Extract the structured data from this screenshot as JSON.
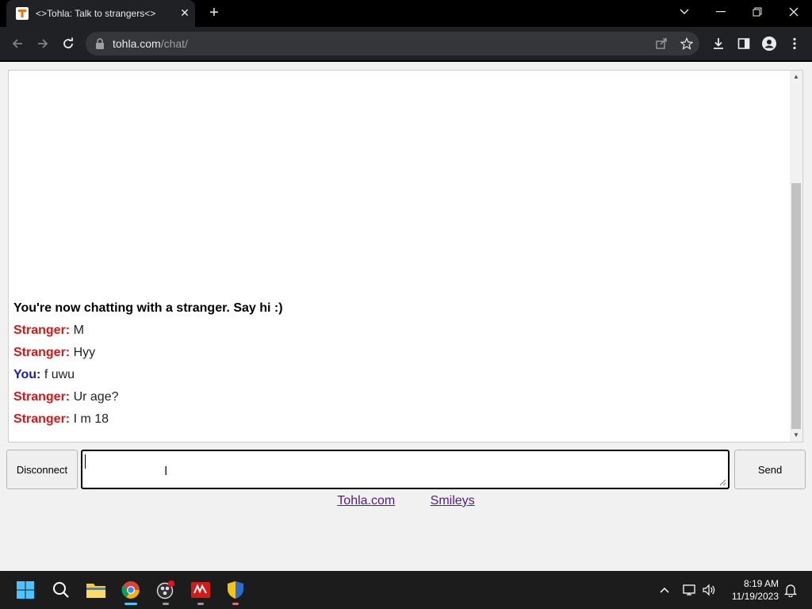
{
  "browser": {
    "tab": {
      "title": "<>Tohla: Talk to strangers<>"
    },
    "url_host": "tohla.com",
    "url_path": "/chat/",
    "icons": [
      "tab-favicon",
      "close-icon",
      "plus-icon",
      "chevron-down-icon",
      "minimize-icon",
      "restore-icon",
      "close-window-icon",
      "back-icon",
      "forward-icon",
      "reload-icon",
      "lock-icon",
      "share-icon",
      "star-icon",
      "download-icon",
      "side-panel-icon",
      "profile-icon",
      "more-icon"
    ]
  },
  "chat": {
    "system_message": "You're now chatting with a stranger. Say hi :)",
    "messages": [
      {
        "sender": "Stranger:",
        "text": "M"
      },
      {
        "sender": "Stranger:",
        "text": "Hyy"
      },
      {
        "sender": "You:",
        "text": "f uwu"
      },
      {
        "sender": "Stranger:",
        "text": "Ur age?"
      },
      {
        "sender": "Stranger:",
        "text": "I m 18"
      }
    ],
    "input_value": "",
    "cursor_glyph": "I"
  },
  "controls": {
    "disconnect_label": "Disconnect",
    "send_label": "Send"
  },
  "footer": {
    "link1": "Tohla.com",
    "link2": "Smileys"
  },
  "taskbar": {
    "apps": [
      "windows-start-icon",
      "search-icon",
      "file-explorer-icon",
      "chrome-icon",
      "obs-icon",
      "app-red-icon",
      "security-shield-icon"
    ],
    "time": "8:19 AM",
    "date": "11/19/2023"
  },
  "colors": {
    "stranger": "#d11a1a",
    "you": "#1a1ab8",
    "link": "#551a8b"
  }
}
